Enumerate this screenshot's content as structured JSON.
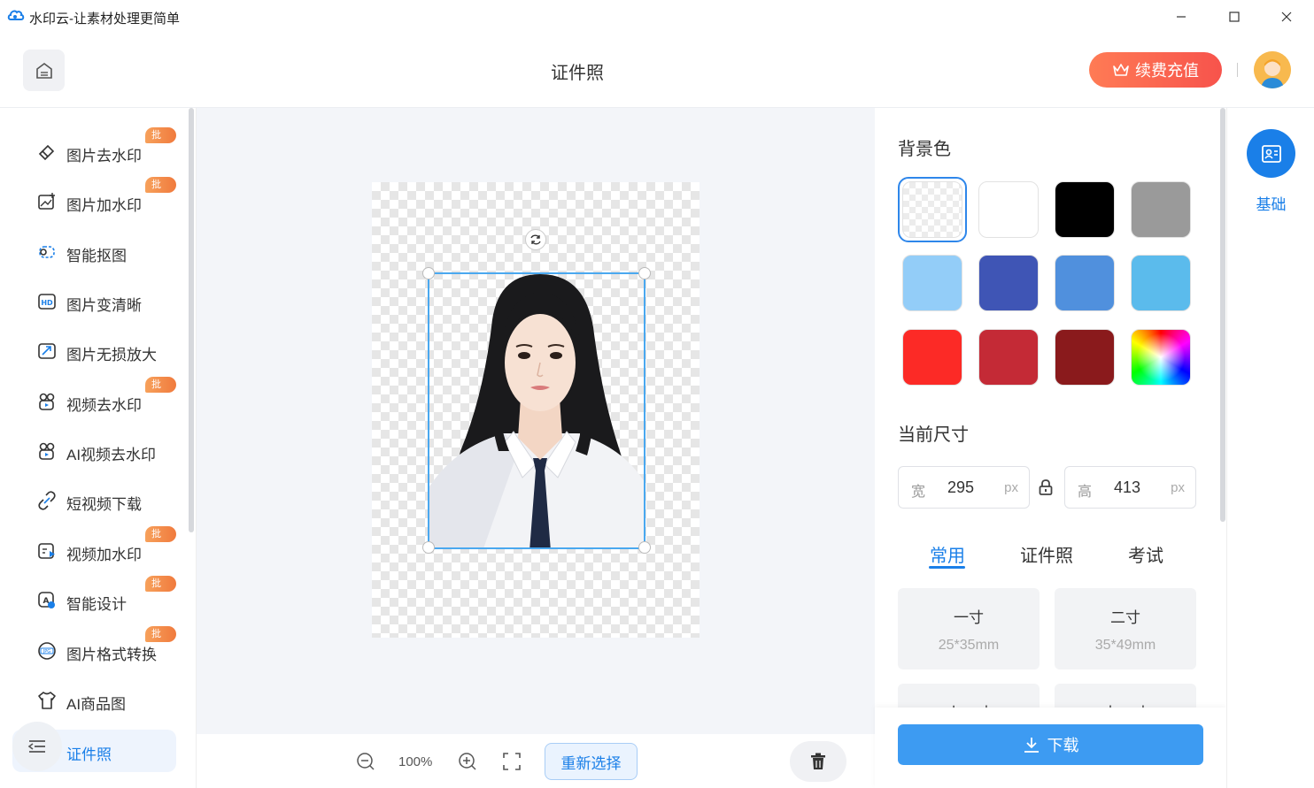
{
  "window": {
    "title": "水印云-让素材处理更简单"
  },
  "header": {
    "page_title": "证件照",
    "recharge_label": "续费充值"
  },
  "sidebar": {
    "items": [
      {
        "label": "图片去水印",
        "badge": "批量",
        "icon": "eraser-icon"
      },
      {
        "label": "图片加水印",
        "badge": "批量",
        "icon": "image-add-icon"
      },
      {
        "label": "智能抠图",
        "badge": "",
        "icon": "cutout-icon"
      },
      {
        "label": "图片变清晰",
        "badge": "",
        "icon": "hd-icon"
      },
      {
        "label": "图片无损放大",
        "badge": "",
        "icon": "enlarge-icon"
      },
      {
        "label": "视频去水印",
        "badge": "批量",
        "icon": "video-eraser-icon"
      },
      {
        "label": "AI视频去水印",
        "badge": "",
        "icon": "ai-video-icon"
      },
      {
        "label": "短视频下载",
        "badge": "",
        "icon": "link-icon"
      },
      {
        "label": "视频加水印",
        "badge": "批量",
        "icon": "video-add-icon"
      },
      {
        "label": "智能设计",
        "badge": "批量",
        "icon": "design-icon"
      },
      {
        "label": "图片格式转换",
        "badge": "批量",
        "icon": "jpg-icon"
      },
      {
        "label": "AI商品图",
        "badge": "",
        "icon": "shirt-icon"
      },
      {
        "label": "证件照",
        "badge": "",
        "icon": "id-photo-icon",
        "active": true
      }
    ]
  },
  "toolbar": {
    "zoom": "100%",
    "reselect_label": "重新选择"
  },
  "panel": {
    "background_title": "背景色",
    "colors": [
      "transparent",
      "#ffffff",
      "#000000",
      "#9a9a9a",
      "#93cdf8",
      "#3f55b5",
      "#5090dd",
      "#5bbbec",
      "#fc2a26",
      "#c42a36",
      "#8a1a1c",
      "picker"
    ],
    "selected_color": "transparent",
    "size_title": "当前尺寸",
    "width_label": "宽",
    "width_value": "295",
    "height_label": "高",
    "height_value": "413",
    "unit": "px",
    "tabs": [
      "常用",
      "证件照",
      "考试"
    ],
    "active_tab": "常用",
    "presets": [
      {
        "name": "一寸",
        "dim": "25*35mm"
      },
      {
        "name": "二寸",
        "dim": "35*49mm"
      },
      {
        "name": "小一寸",
        "dim": ""
      },
      {
        "name": "大一寸",
        "dim": ""
      }
    ],
    "download_label": "下载"
  },
  "rail": {
    "label": "基础"
  }
}
